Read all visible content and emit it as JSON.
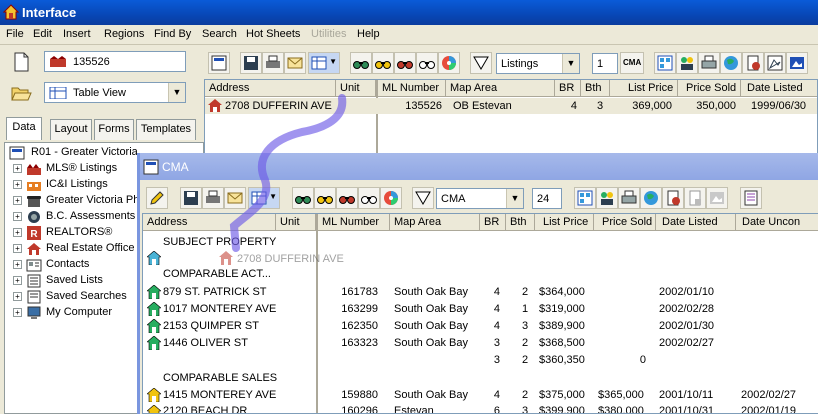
{
  "window": {
    "title": "Interface"
  },
  "menu": [
    "File",
    "Edit",
    "Insert",
    "Regions",
    "Find By",
    "Search",
    "Hot Sheets",
    "Utilities",
    "Help"
  ],
  "menu_disabled": [
    "Utilities"
  ],
  "left": {
    "mls_field": "135526",
    "view_select": "Table View",
    "tabs": [
      "Data",
      "Layout",
      "Forms",
      "Templates"
    ],
    "active_tab": "Data",
    "tree_root": "R01 - Greater Victoria",
    "tree_items": [
      "MLS® Listings",
      "IC&I Listings",
      "Greater Victoria Ph",
      "B.C. Assessments",
      "REALTORS®",
      "Real Estate Office",
      "Contacts",
      "Saved Lists",
      "Saved Searches",
      "My Computer"
    ]
  },
  "main": {
    "listings_select": "Listings",
    "page_field": "1",
    "cma_label": "CMA",
    "columns": [
      "Address",
      "Unit",
      "ML Number",
      "Map Area",
      "BR",
      "Bth",
      "List Price",
      "Price Sold",
      "Date Listed"
    ],
    "row": {
      "address": "2708 DUFFERIN AVE",
      "unit": "",
      "ml": "135526",
      "map": "OB Estevan",
      "br": "4",
      "bth": "3",
      "list": "369,000",
      "sold": "350,000",
      "date": "1999/06/30"
    }
  },
  "cma": {
    "title": "CMA",
    "select": "CMA",
    "count_field": "24",
    "columns": [
      "Address",
      "Unit",
      "ML Number",
      "Map Area",
      "BR",
      "Bth",
      "List Price",
      "Price Sold",
      "Date Listed",
      "Date Uncon"
    ],
    "subject_label": "SUBJECT PROPERTY",
    "drag_label": "2708 DUFFERIN AVE",
    "comp_active_label": "COMPARABLE ACT...",
    "active_rows": [
      {
        "address": "879 ST. PATRICK ST",
        "ml": "161783",
        "map": "South Oak Bay",
        "br": "4",
        "bth": "2",
        "list": "$364,000",
        "sold": "",
        "date": "2002/01/10",
        "uncon": ""
      },
      {
        "address": "1017 MONTEREY AVE",
        "ml": "163299",
        "map": "South Oak Bay",
        "br": "4",
        "bth": "1",
        "list": "$319,000",
        "sold": "",
        "date": "2002/02/28",
        "uncon": ""
      },
      {
        "address": "2153 QUIMPER ST",
        "ml": "162350",
        "map": "South Oak Bay",
        "br": "4",
        "bth": "3",
        "list": "$389,900",
        "sold": "",
        "date": "2002/01/30",
        "uncon": ""
      },
      {
        "address": "1446 OLIVER ST",
        "ml": "163323",
        "map": "South Oak Bay",
        "br": "3",
        "bth": "2",
        "list": "$368,500",
        "sold": "",
        "date": "2002/02/27",
        "uncon": ""
      }
    ],
    "summary_row": {
      "br": "3",
      "bth": "2",
      "list": "$360,350",
      "sold": "0"
    },
    "comp_sales_label": "COMPARABLE SALES",
    "sales_rows": [
      {
        "address": "1415 MONTEREY AVE",
        "ml": "159880",
        "map": "South Oak Bay",
        "br": "4",
        "bth": "2",
        "list": "$375,000",
        "sold": "$365,000",
        "date": "2001/10/11",
        "uncon": "2002/02/27"
      },
      {
        "address": "2120 BEACH DR",
        "ml": "160296",
        "map": "Estevan",
        "br": "6",
        "bth": "3",
        "list": "$399,900",
        "sold": "$380,000",
        "date": "2001/10/31",
        "uncon": "2002/01/19"
      }
    ]
  }
}
